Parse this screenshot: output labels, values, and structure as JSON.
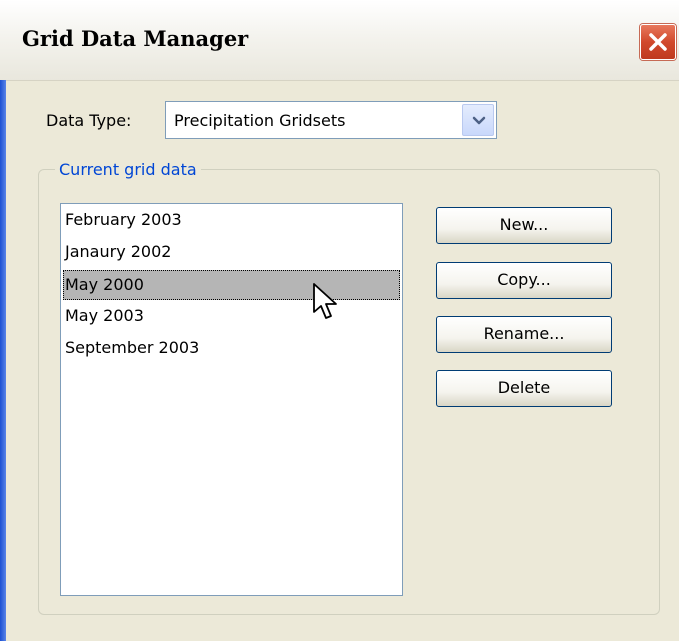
{
  "window": {
    "title": "Grid Data Manager"
  },
  "data_type": {
    "label": "Data Type:",
    "selected": "Precipitation Gridsets"
  },
  "group": {
    "legend": "Current grid data"
  },
  "grid_list": {
    "items": [
      {
        "label": "February 2003",
        "selected": false
      },
      {
        "label": "Janaury 2002",
        "selected": false
      },
      {
        "label": "May 2000",
        "selected": true
      },
      {
        "label": "May 2003",
        "selected": false
      },
      {
        "label": "September 2003",
        "selected": false
      }
    ]
  },
  "buttons": {
    "new_label": "New...",
    "copy_label": "Copy...",
    "rename_label": "Rename...",
    "delete_label": "Delete"
  },
  "icons": {
    "close": "close-icon",
    "dropdown": "chevron-down-icon",
    "cursor": "mouse-pointer-icon"
  },
  "colors": {
    "close_button": "#d1492c",
    "legend_text": "#0046d5",
    "selection": "#b5b5b5",
    "window_bg": "#ece9d8"
  }
}
